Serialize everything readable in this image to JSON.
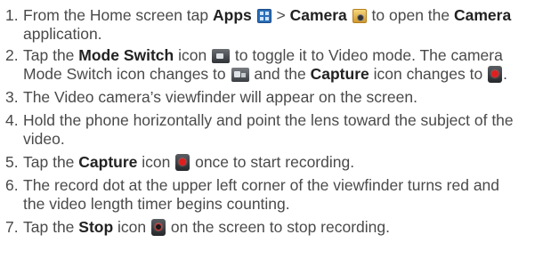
{
  "steps": [
    {
      "num": "1.",
      "a": "From the Home screen tap ",
      "b1": "Apps",
      "c": " ",
      "d": " > ",
      "b2": "Camera",
      "e": " ",
      "f": " to open the ",
      "b3": "Camera",
      "g": "application."
    },
    {
      "num": "2.",
      "a": "Tap the ",
      "b1": "Mode Switch",
      "c": " icon ",
      "d": " to toggle it to Video mode. The camera",
      "e": "Mode Switch icon changes to ",
      "f": " and the ",
      "b2": "Capture",
      "g": " icon changes to ",
      "h": "."
    },
    {
      "num": "3.",
      "a": "The Video camera’s viewfinder will appear on the screen."
    },
    {
      "num": "4.",
      "a": "Hold the phone horizontally and point the lens toward the subject of the",
      "b": "video."
    },
    {
      "num": "5.",
      "a": "Tap the ",
      "b1": "Capture",
      "c": " icon ",
      "d": " once to start recording."
    },
    {
      "num": "6.",
      "a": "The record dot at the upper left corner of the viewfinder turns red and",
      "b": "the video length timer begins counting."
    },
    {
      "num": "7.",
      "a": "Tap the ",
      "b1": "Stop",
      "c": " icon ",
      "d": " on the screen to stop recording."
    }
  ],
  "icons": {
    "apps": "apps-grid-icon",
    "camera": "camera-app-icon",
    "mode_switch": "mode-switch-icon",
    "mode_switch_video": "mode-switch-video-icon",
    "capture": "capture-record-icon",
    "stop": "stop-icon"
  },
  "colors": {
    "text": "#4a4a4a",
    "bold": "#222222",
    "record": "#e01e1e"
  }
}
